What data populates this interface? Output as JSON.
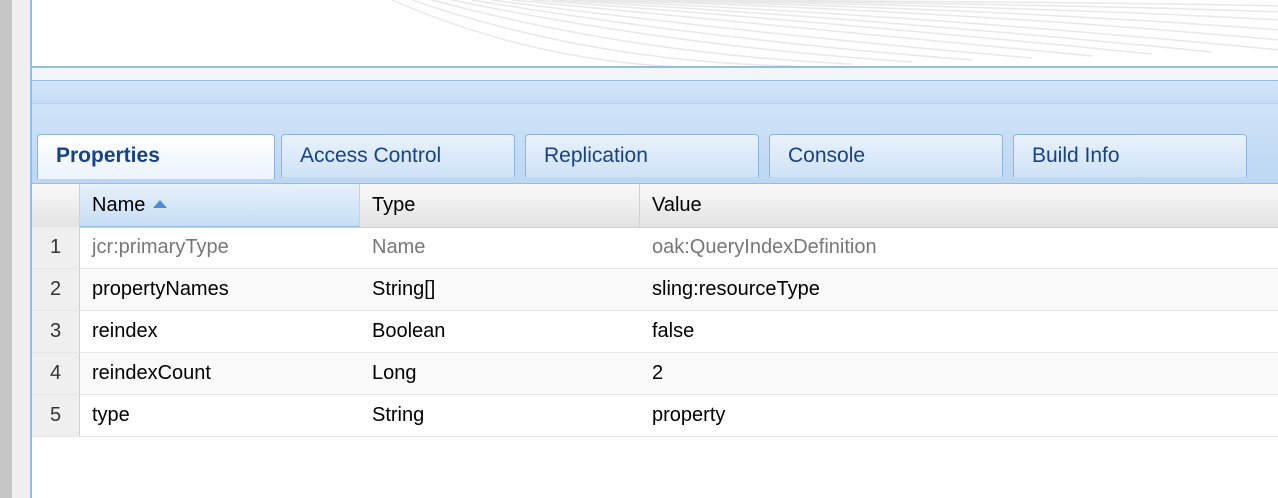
{
  "tabs": [
    {
      "label": "Properties",
      "active": true
    },
    {
      "label": "Access Control",
      "active": false
    },
    {
      "label": "Replication",
      "active": false
    },
    {
      "label": "Console",
      "active": false
    },
    {
      "label": "Build Info",
      "active": false
    }
  ],
  "grid": {
    "columns": {
      "name": "Name",
      "type": "Type",
      "value": "Value"
    },
    "sort": {
      "column": "Name",
      "direction": "ascending",
      "icon": "sort-asc-icon"
    },
    "rows": [
      {
        "num": "1",
        "name": "jcr:primaryType",
        "type": "Name",
        "value": "oak:QueryIndexDefinition",
        "readonly": true
      },
      {
        "num": "2",
        "name": "propertyNames",
        "type": "String[]",
        "value": "sling:resourceType"
      },
      {
        "num": "3",
        "name": "reindex",
        "type": "Boolean",
        "value": "false"
      },
      {
        "num": "4",
        "name": "reindexCount",
        "type": "Long",
        "value": "2"
      },
      {
        "num": "5",
        "name": "type",
        "type": "String",
        "value": "property"
      }
    ]
  },
  "colors": {
    "tab_text": "#15428b",
    "panel_border": "#99bbe8",
    "sort_arrow": "#4b8fd6"
  }
}
